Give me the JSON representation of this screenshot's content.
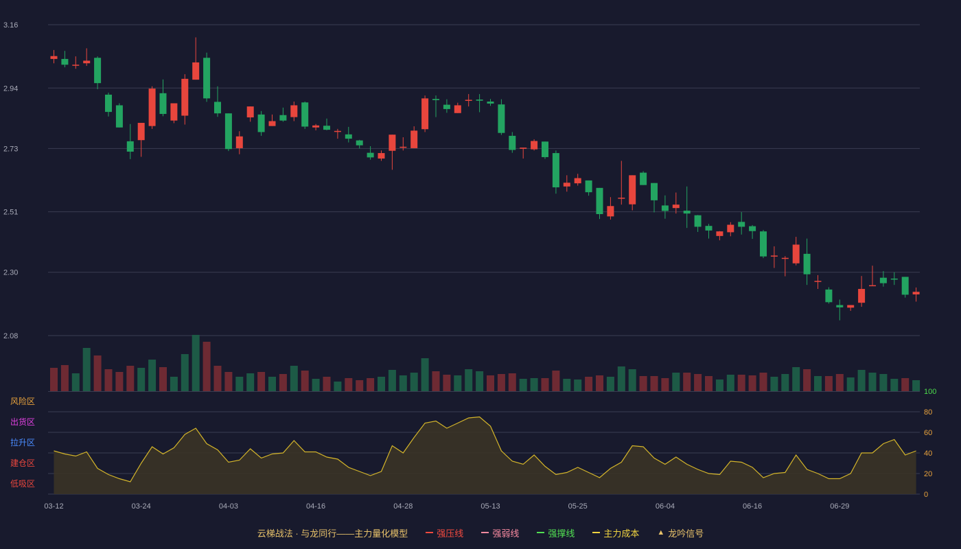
{
  "colors": {
    "background": "#181a2d",
    "grid": "#3a3d52",
    "axis_text": "#a9abb8",
    "up": "#e8463d",
    "down": "#23a461",
    "volume_up": "#6e2a33",
    "volume_down": "#1d5a46",
    "indicator_line": "#d4b52a",
    "indicator_fill": "#3a3326",
    "indicator_axis": "#e8a23c",
    "indicator_max_label": "#4cdb4c"
  },
  "chart_data": {
    "type": "candlestick",
    "price_axis": {
      "ticks": [
        "3.16",
        "2.94",
        "2.73",
        "2.51",
        "2.30",
        "2.08"
      ],
      "range": [
        2.08,
        3.16
      ]
    },
    "x_tick_labels": [
      {
        "index": 0,
        "label": "03-12"
      },
      {
        "index": 8,
        "label": "03-24"
      },
      {
        "index": 16,
        "label": "04-03"
      },
      {
        "index": 24,
        "label": "04-16"
      },
      {
        "index": 32,
        "label": "04-28"
      },
      {
        "index": 40,
        "label": "05-13"
      },
      {
        "index": 48,
        "label": "05-25"
      },
      {
        "index": 56,
        "label": "06-04"
      },
      {
        "index": 64,
        "label": "06-16"
      },
      {
        "index": 72,
        "label": "06-29"
      }
    ],
    "candles": [
      [
        3.041,
        3.051,
        3.026,
        3.072
      ],
      [
        3.041,
        3.021,
        3.012,
        3.069
      ],
      [
        3.021,
        3.021,
        3.007,
        3.05
      ],
      [
        3.026,
        3.035,
        3.017,
        3.078
      ],
      [
        3.045,
        2.957,
        2.936,
        3.05
      ],
      [
        2.917,
        2.857,
        2.841,
        2.924
      ],
      [
        2.88,
        2.803,
        2.803,
        2.887
      ],
      [
        2.755,
        2.719,
        2.693,
        2.815
      ],
      [
        2.759,
        2.819,
        2.701,
        2.819
      ],
      [
        2.808,
        2.938,
        2.798,
        2.946
      ],
      [
        2.922,
        2.85,
        2.842,
        2.97
      ],
      [
        2.827,
        2.887,
        2.818,
        2.887
      ],
      [
        2.844,
        2.972,
        2.813,
        2.988
      ],
      [
        2.969,
        3.029,
        2.969,
        3.116
      ],
      [
        3.045,
        2.904,
        2.892,
        3.063
      ],
      [
        2.892,
        2.852,
        2.84,
        2.946
      ],
      [
        2.852,
        2.728,
        2.721,
        2.852
      ],
      [
        2.731,
        2.772,
        2.71,
        2.79
      ],
      [
        2.838,
        2.876,
        2.823,
        2.876
      ],
      [
        2.848,
        2.787,
        2.774,
        2.86
      ],
      [
        2.808,
        2.825,
        2.808,
        2.848
      ],
      [
        2.846,
        2.827,
        2.823,
        2.872
      ],
      [
        2.839,
        2.88,
        2.825,
        2.893
      ],
      [
        2.89,
        2.806,
        2.798,
        2.893
      ],
      [
        2.803,
        2.81,
        2.793,
        2.815
      ],
      [
        2.809,
        2.795,
        2.793,
        2.834
      ],
      [
        2.788,
        2.791,
        2.764,
        2.798
      ],
      [
        2.779,
        2.764,
        2.751,
        2.805
      ],
      [
        2.758,
        2.741,
        2.73,
        2.76
      ],
      [
        2.715,
        2.699,
        2.691,
        2.738
      ],
      [
        2.695,
        2.714,
        2.687,
        2.723
      ],
      [
        2.722,
        2.778,
        2.656,
        2.778
      ],
      [
        2.736,
        2.736,
        2.723,
        2.769
      ],
      [
        2.731,
        2.792,
        2.731,
        2.807
      ],
      [
        2.797,
        2.904,
        2.787,
        2.914
      ],
      [
        2.902,
        2.898,
        2.839,
        2.914
      ],
      [
        2.882,
        2.867,
        2.854,
        2.901
      ],
      [
        2.853,
        2.88,
        2.853,
        2.889
      ],
      [
        2.899,
        2.899,
        2.876,
        2.919
      ],
      [
        2.9,
        2.896,
        2.856,
        2.919
      ],
      [
        2.893,
        2.886,
        2.878,
        2.902
      ],
      [
        2.883,
        2.784,
        2.777,
        2.901
      ],
      [
        2.774,
        2.725,
        2.715,
        2.787
      ],
      [
        2.729,
        2.733,
        2.695,
        2.733
      ],
      [
        2.727,
        2.756,
        2.723,
        2.762
      ],
      [
        2.754,
        2.7,
        2.694,
        2.754
      ],
      [
        2.714,
        2.595,
        2.573,
        2.723
      ],
      [
        2.598,
        2.611,
        2.58,
        2.637
      ],
      [
        2.609,
        2.627,
        2.601,
        2.642
      ],
      [
        2.619,
        2.578,
        2.566,
        2.619
      ],
      [
        2.593,
        2.502,
        2.485,
        2.593
      ],
      [
        2.494,
        2.53,
        2.483,
        2.561
      ],
      [
        2.556,
        2.559,
        2.535,
        2.687
      ],
      [
        2.536,
        2.637,
        2.515,
        2.637
      ],
      [
        2.646,
        2.603,
        2.603,
        2.651
      ],
      [
        2.61,
        2.55,
        2.508,
        2.61
      ],
      [
        2.532,
        2.513,
        2.486,
        2.567
      ],
      [
        2.523,
        2.535,
        2.504,
        2.577
      ],
      [
        2.514,
        2.504,
        2.454,
        2.598
      ],
      [
        2.498,
        2.458,
        2.44,
        2.499
      ],
      [
        2.461,
        2.445,
        2.417,
        2.468
      ],
      [
        2.426,
        2.442,
        2.411,
        2.443
      ],
      [
        2.439,
        2.465,
        2.425,
        2.474
      ],
      [
        2.475,
        2.458,
        2.431,
        2.509
      ],
      [
        2.46,
        2.443,
        2.416,
        2.464
      ],
      [
        2.442,
        2.355,
        2.349,
        2.447
      ],
      [
        2.358,
        2.358,
        2.315,
        2.39
      ],
      [
        2.35,
        2.35,
        2.286,
        2.356
      ],
      [
        2.331,
        2.396,
        2.324,
        2.423
      ],
      [
        2.364,
        2.293,
        2.256,
        2.417
      ],
      [
        2.27,
        2.27,
        2.242,
        2.29
      ],
      [
        2.24,
        2.196,
        2.191,
        2.248
      ],
      [
        2.186,
        2.178,
        2.133,
        2.205
      ],
      [
        2.177,
        2.186,
        2.166,
        2.186
      ],
      [
        2.194,
        2.242,
        2.18,
        2.287
      ],
      [
        2.255,
        2.255,
        2.255,
        2.323
      ],
      [
        2.281,
        2.262,
        2.25,
        2.304
      ],
      [
        2.278,
        2.276,
        2.256,
        2.3
      ],
      [
        2.284,
        2.222,
        2.212,
        2.284
      ],
      [
        2.223,
        2.232,
        2.198,
        2.247
      ]
    ],
    "volume": [
      [
        34,
        "up"
      ],
      [
        38,
        "up"
      ],
      [
        26,
        "down"
      ],
      [
        63,
        "down"
      ],
      [
        52,
        "up"
      ],
      [
        32,
        "up"
      ],
      [
        28,
        "up"
      ],
      [
        37,
        "up"
      ],
      [
        34,
        "down"
      ],
      [
        46,
        "down"
      ],
      [
        35,
        "up"
      ],
      [
        21,
        "down"
      ],
      [
        54,
        "down"
      ],
      [
        82,
        "down"
      ],
      [
        72,
        "up"
      ],
      [
        37,
        "up"
      ],
      [
        28,
        "up"
      ],
      [
        21,
        "down"
      ],
      [
        26,
        "down"
      ],
      [
        28,
        "up"
      ],
      [
        21,
        "down"
      ],
      [
        25,
        "up"
      ],
      [
        37,
        "down"
      ],
      [
        30,
        "up"
      ],
      [
        18,
        "down"
      ],
      [
        21,
        "up"
      ],
      [
        14,
        "down"
      ],
      [
        19,
        "up"
      ],
      [
        16,
        "up"
      ],
      [
        19,
        "up"
      ],
      [
        21,
        "down"
      ],
      [
        31,
        "down"
      ],
      [
        23,
        "down"
      ],
      [
        27,
        "down"
      ],
      [
        48,
        "down"
      ],
      [
        29,
        "up"
      ],
      [
        24,
        "up"
      ],
      [
        23,
        "down"
      ],
      [
        32,
        "down"
      ],
      [
        29,
        "down"
      ],
      [
        23,
        "up"
      ],
      [
        25,
        "up"
      ],
      [
        26,
        "up"
      ],
      [
        18,
        "down"
      ],
      [
        19,
        "down"
      ],
      [
        19,
        "up"
      ],
      [
        30,
        "up"
      ],
      [
        18,
        "down"
      ],
      [
        17,
        "down"
      ],
      [
        21,
        "up"
      ],
      [
        23,
        "up"
      ],
      [
        21,
        "down"
      ],
      [
        36,
        "down"
      ],
      [
        32,
        "down"
      ],
      [
        22,
        "up"
      ],
      [
        22,
        "up"
      ],
      [
        19,
        "up"
      ],
      [
        27,
        "down"
      ],
      [
        27,
        "up"
      ],
      [
        25,
        "up"
      ],
      [
        22,
        "up"
      ],
      [
        17,
        "down"
      ],
      [
        24,
        "down"
      ],
      [
        24,
        "up"
      ],
      [
        23,
        "up"
      ],
      [
        27,
        "up"
      ],
      [
        21,
        "down"
      ],
      [
        25,
        "down"
      ],
      [
        35,
        "down"
      ],
      [
        32,
        "up"
      ],
      [
        22,
        "down"
      ],
      [
        22,
        "up"
      ],
      [
        25,
        "up"
      ],
      [
        20,
        "down"
      ],
      [
        31,
        "down"
      ],
      [
        27,
        "down"
      ],
      [
        25,
        "down"
      ],
      [
        18,
        "down"
      ],
      [
        19,
        "up"
      ],
      [
        16,
        "down"
      ]
    ],
    "indicator": {
      "axis_ticks": [
        "100",
        "80",
        "60",
        "40",
        "20",
        "0"
      ],
      "zones": [
        "风险区",
        "出货区",
        "拉升区",
        "建仓区",
        "低吸区"
      ],
      "values": [
        42,
        39,
        37,
        41,
        25,
        19,
        15,
        12,
        30,
        46,
        39,
        45,
        58,
        64,
        49,
        43,
        31,
        33,
        44,
        35,
        39,
        40,
        52,
        41,
        41,
        36,
        34,
        26,
        22,
        18,
        22,
        47,
        40,
        55,
        69,
        71,
        64,
        69,
        74,
        75,
        66,
        42,
        32,
        29,
        38,
        27,
        19,
        21,
        26,
        21,
        16,
        25,
        31,
        47,
        46,
        35,
        29,
        36,
        29,
        24,
        20,
        19,
        32,
        31,
        26,
        16,
        20,
        21,
        38,
        24,
        20,
        15,
        15,
        20,
        40,
        40,
        49,
        53,
        38,
        42
      ]
    }
  },
  "legend": [
    {
      "text": "云梯战法 · 与龙同行——主力量化模型",
      "type": "title",
      "color": "#e8c26a"
    },
    {
      "text": "强压线",
      "type": "solid",
      "color": "#f24a3f"
    },
    {
      "text": "强弱线",
      "type": "dashed",
      "color": "#f88aa0"
    },
    {
      "text": "强撑线",
      "type": "solid",
      "color": "#52e052"
    },
    {
      "text": "主力成本",
      "type": "dashed",
      "color": "#f1d441"
    },
    {
      "text": "龙吟信号",
      "type": "triangle",
      "color": "#e8c26a"
    }
  ]
}
